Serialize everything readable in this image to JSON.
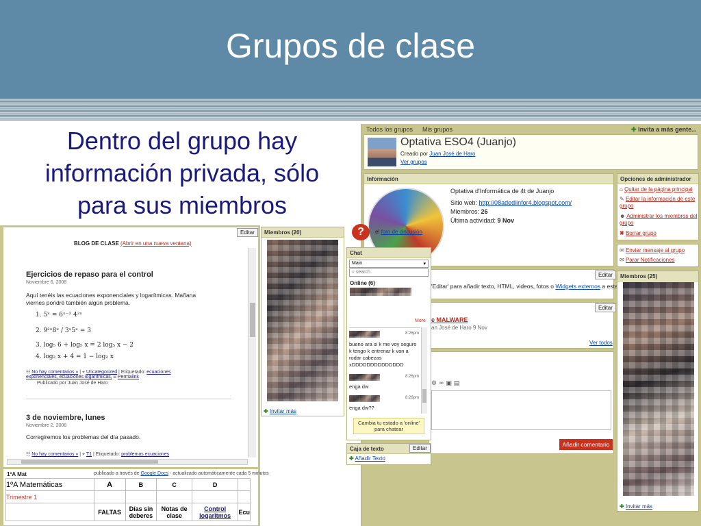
{
  "slide": {
    "title": "Grupos de clase",
    "subtitle_lines": [
      "Dentro del grupo hay",
      "información privada, sólo",
      "para sus miembros"
    ]
  },
  "blog": {
    "edit": "Editar",
    "header_label": "BLOG DE CLASE",
    "header_link": "(Abrir en una nueva ventana)",
    "post1": {
      "title": "Ejercicios de repaso para el control",
      "date": "Noviembre 6, 2008",
      "body1": "Aquí tenéis las ecuaciones exponenciales y logarítmicas. Mañana",
      "body2": "viernes pondré también algún problema.",
      "equations": [
        "1.  5ˣ = 6ˣ⁻² 4²ˣ",
        "2.  9²ˣ8ˣ / 3ˣ5ˣ = 3",
        "3.  log₅ 6 + log₅ x = 2 log₅ x − 2",
        "4.  log₂ x + 4 = 1 − log₂ x"
      ],
      "comments": "No hay comentarios »",
      "category": "Uncategorized",
      "tagged": "| Etiquetado:",
      "tags1": "ecuaciones",
      "tags2": "exponenciales, ecuaciones logarítmicas,",
      "permalink": "Permalink",
      "published": "Publicado por Juan José de Haro"
    },
    "post2": {
      "title": "3 de noviembre, lunes",
      "date": "Noviembre 2, 2008",
      "body": "Corregiremos los problemas del día pasado.",
      "comments": "No hay comentarios »",
      "category": "T1",
      "tagged": "| Etiquetado:",
      "tags": "problemas ecuaciones"
    }
  },
  "sheet": {
    "title": "1ºA Mat",
    "published_via": "publicado a través de",
    "google_docs": "Google Docs",
    "updated": "- actualizado automáticamente cada 5 minutos",
    "subject": "1ºA Matemáticas",
    "cols": [
      "A",
      "B",
      "C",
      "D",
      ""
    ],
    "trimestre": "Trimestre 1",
    "headers": [
      "FALTAS",
      "Días sin deberes",
      "Notas de clase",
      "Control logaritmos",
      "Ecu"
    ]
  },
  "members_left": {
    "title": "Miembros (20)",
    "invite": "Invitar más"
  },
  "discussion": {
    "text": "el",
    "link": "foro de discusión"
  },
  "chat": {
    "title": "Chat",
    "room": "Main",
    "search": "search",
    "online": "Online (6)",
    "more": "More",
    "messages": [
      {
        "time": "8:26pm",
        "text": "bueno ara si k me voy seguro k tengo k entrenar k van a rodar cabezas xDDDDDDDDDDDDDD"
      },
      {
        "time": "8:26pm",
        "text": "enga dw"
      },
      {
        "time": "8:26pm",
        "text": "enga dw??"
      }
    ],
    "status_hint": "Cambia tu estado a 'online' para chatear"
  },
  "textbox": {
    "title": "Caja de texto",
    "edit": "Editar",
    "add": "Añadir Texto"
  },
  "group": {
    "nav_all": "Todos los grupos",
    "nav_mine": "Mis grupos",
    "invite_more": "Invita a más gente...",
    "name": "Optativa ESO4 (Juanjo)",
    "created_by_label": "Creado por",
    "creator": "Juan José de Haro",
    "see_groups": "Ver grupos",
    "info_title": "Información",
    "description": "Optativa d'Informática de 4t de Juanjo",
    "website_label": "Sitio web:",
    "website": "http://08adediinfor4.blogspot.com/",
    "members_label": "Miembros:",
    "members_count": "26",
    "activity_label": "Última actividad:",
    "activity": "9 Nov",
    "edit": "Editar",
    "text_hint_prefix": "'Editar' para añadir texto, HTML, videos, fotos o",
    "widgets": "Widgets externos",
    "text_hint_suffix": "a esta",
    "malware_title": "e MALWARE",
    "malware_meta": "an José de Haro 9 Nov",
    "see_all": "Ver todos",
    "add_comment": "Añadir comentario"
  },
  "admin": {
    "title": "Opciones de administrador",
    "items": [
      "Quitar de la página principal",
      "Editar la información de este grupo",
      "Administrar los miembros del grupo",
      "Borrar grupo"
    ],
    "send_message": "Enviar mensaje al grupo",
    "notifications": "Parar Notificaciones"
  },
  "members_right": {
    "title": "Miembros (25)",
    "invite": "Invitar más"
  },
  "colors": {
    "header": "#5e8aa8",
    "subtitle": "#1a1a7c",
    "panel_bg": "#c9c58f",
    "add_comment_btn": "#c8321e"
  }
}
